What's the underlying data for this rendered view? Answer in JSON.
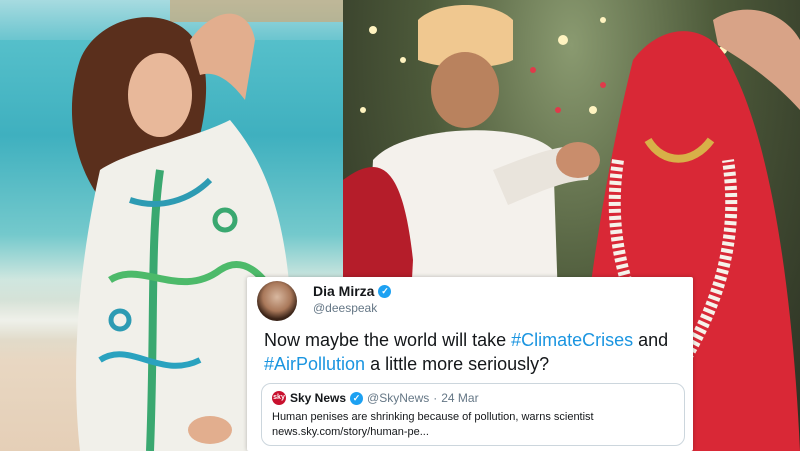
{
  "tweet": {
    "author_name": "Dia Mirza",
    "author_handle": "@deespeak",
    "verified_icon": "verified-badge-icon",
    "text_before": "Now maybe the world will take ",
    "hashtag_1": "#ClimateCrises",
    "text_middle": " and ",
    "hashtag_2": "#AirPollution",
    "text_after": " a little more seriously?",
    "quoted": {
      "source_name": "Sky News",
      "source_handle": "@SkyNews",
      "separator": "·",
      "date": "24 Mar",
      "headline": "Human penises are shrinking because of pollution, warns scientist",
      "link": "news.sky.com/story/human-pe..."
    }
  },
  "colors": {
    "hashtag": "#1b95e0",
    "verified": "#1da1f2",
    "sky_brand": "#c8102e"
  }
}
